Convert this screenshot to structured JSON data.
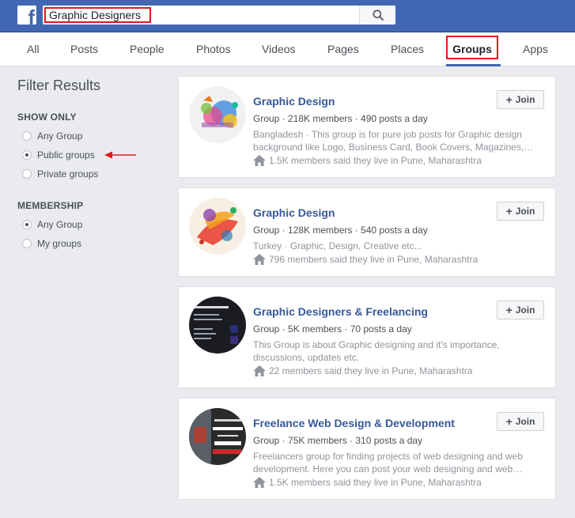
{
  "search": {
    "value": "Graphic Designers"
  },
  "tabs": [
    {
      "label": "All"
    },
    {
      "label": "Posts"
    },
    {
      "label": "People"
    },
    {
      "label": "Photos"
    },
    {
      "label": "Videos"
    },
    {
      "label": "Pages"
    },
    {
      "label": "Places"
    },
    {
      "label": "Groups"
    },
    {
      "label": "Apps"
    }
  ],
  "sidebar": {
    "title": "Filter Results",
    "show_only": {
      "heading": "SHOW ONLY",
      "options": [
        {
          "label": "Any Group",
          "checked": false
        },
        {
          "label": "Public groups",
          "checked": true
        },
        {
          "label": "Private groups",
          "checked": false
        }
      ]
    },
    "membership": {
      "heading": "MEMBERSHIP",
      "options": [
        {
          "label": "Any Group",
          "checked": true
        },
        {
          "label": "My groups",
          "checked": false
        }
      ]
    }
  },
  "join_label": "Join",
  "colors": {
    "brand_blue": "#4267b2",
    "link_blue": "#365899",
    "highlight_red": "#e0181b"
  },
  "results": [
    {
      "title": "Graphic Design",
      "meta": "Group · 218K members · 490 posts a day",
      "desc": "Bangladesh · This group is for pure job posts for Graphic design background like Logo, Business Card, Book Covers, Magazines,…",
      "live": "1.5K members said they live in Pune, Maharashtra"
    },
    {
      "title": "Graphic Design",
      "meta": "Group · 128K members · 540 posts a day",
      "desc": "Turkey · Graphic, Design, Creative etc...",
      "live": "796 members said they live in Pune, Maharashtra"
    },
    {
      "title": "Graphic Designers & Freelancing",
      "meta": "Group · 5K members · 70 posts a day",
      "desc": "This Group is about Graphic designing and it's importance, discussions, updates etc.",
      "live": "22 members said they live in Pune, Maharashtra"
    },
    {
      "title": "Freelance Web Design & Development",
      "meta": "Group · 75K members · 310 posts a day",
      "desc": "Freelancers group for finding projects of web designing and web development. Here you can post your web designing and web…",
      "live": "1.5K members said they live in Pune, Maharashtra"
    }
  ]
}
